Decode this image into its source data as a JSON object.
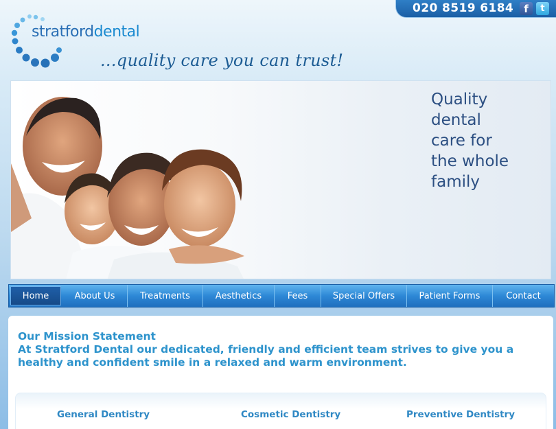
{
  "header": {
    "logo": {
      "name": "stratford",
      "name2": "dental"
    },
    "tagline": "...quality care you can trust!",
    "phone": "020 8519 6184",
    "social": {
      "facebook": "f",
      "twitter": "t"
    }
  },
  "hero": {
    "headline_lines": [
      "Quality",
      "dental",
      "care for",
      "the whole",
      "family"
    ]
  },
  "nav": {
    "items": [
      {
        "label": "Home"
      },
      {
        "label": "About Us"
      },
      {
        "label": "Treatments"
      },
      {
        "label": "Aesthetics"
      },
      {
        "label": "Fees"
      },
      {
        "label": "Special Offers"
      },
      {
        "label": "Patient Forms"
      },
      {
        "label": "Contact"
      }
    ],
    "active": "Home"
  },
  "mission": {
    "title": "Our Mission Statement",
    "body": "At Stratford Dental our dedicated, friendly and efficient team strives to give you a healthy and confident smile in a relaxed and warm environment."
  },
  "services": [
    {
      "label": "General Dentistry"
    },
    {
      "label": "Cosmetic Dentistry"
    },
    {
      "label": "Preventive Dentistry"
    }
  ],
  "colors": {
    "brand_blue": "#2a6fb5",
    "nav_blue": "#2d88d6",
    "heading_blue": "#2d93cc"
  }
}
